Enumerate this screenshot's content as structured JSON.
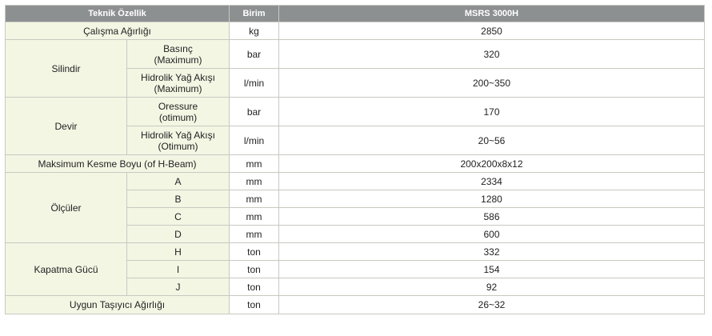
{
  "header": {
    "feature": "Teknik Özellik",
    "unit": "Birim",
    "model": "MSRS 3000H"
  },
  "rows": {
    "weight": {
      "label": "Çalışma Ağırlığı",
      "unit": "kg",
      "value": "2850"
    },
    "cylinder": {
      "label": "Silindir",
      "pressure": {
        "label_line1": "Basınç",
        "label_line2": "(Maximum)",
        "unit": "bar",
        "value": "320"
      },
      "oil_flow": {
        "label_line1": "Hidrolik Yağ Akışı",
        "label_line2": "(Maximum)",
        "unit": "l/min",
        "value": "200~350"
      }
    },
    "rotation": {
      "label": "Devir",
      "pressure": {
        "label_line1": "Oressure",
        "label_line2": "(otimum)",
        "unit": "bar",
        "value": "170"
      },
      "oil_flow": {
        "label_line1": "Hidrolik Yağ Akışı",
        "label_line2": "(Otimum)",
        "unit": "l/min",
        "value": "20~56"
      }
    },
    "max_cut": {
      "label": "Maksimum Kesme Boyu (of H-Beam)",
      "unit": "mm",
      "value": "200x200x8x12"
    },
    "dimensions": {
      "label": "Ölçüler",
      "items": [
        {
          "key": "A",
          "unit": "mm",
          "value": "2334"
        },
        {
          "key": "B",
          "unit": "mm",
          "value": "1280"
        },
        {
          "key": "C",
          "unit": "mm",
          "value": "586"
        },
        {
          "key": "D",
          "unit": "mm",
          "value": "600"
        }
      ]
    },
    "closing_force": {
      "label": "Kapatma Gücü",
      "items": [
        {
          "key": "H",
          "unit": "ton",
          "value": "332"
        },
        {
          "key": "I",
          "unit": "ton",
          "value": "154"
        },
        {
          "key": "J",
          "unit": "ton",
          "value": "92"
        }
      ]
    },
    "carrier": {
      "label": "Uygun Taşıyıcı Ağırlığı",
      "unit": "ton",
      "value": "26~32"
    }
  }
}
